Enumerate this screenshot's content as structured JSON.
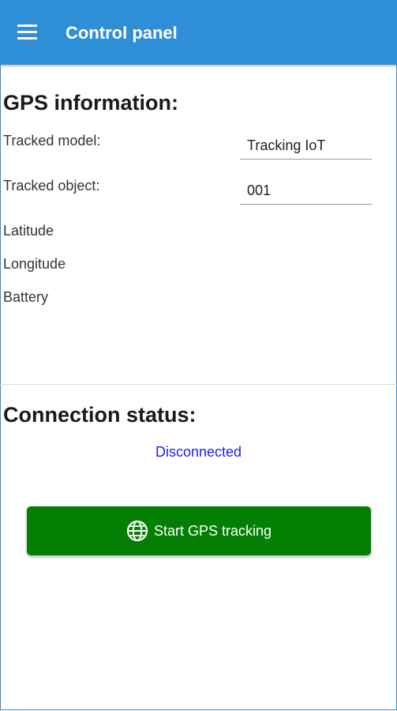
{
  "app_bar": {
    "title": "Control panel",
    "menu_icon": "hamburger-menu-icon",
    "color": "#2f8fd6"
  },
  "gps_section": {
    "title": "GPS information:",
    "tracked_model_label": "Tracked model:",
    "tracked_model_value": "Tracking IoT",
    "tracked_object_label": "Tracked object:",
    "tracked_object_value": "001",
    "latitude_label": "Latitude",
    "longitude_label": "Longitude",
    "battery_label": "Battery"
  },
  "connection_section": {
    "title": "Connection status:",
    "status_text": "Disconnected",
    "status_color": "#2323d6"
  },
  "start_button": {
    "label": "Start GPS tracking",
    "icon": "globe-icon",
    "color": "#038003"
  }
}
